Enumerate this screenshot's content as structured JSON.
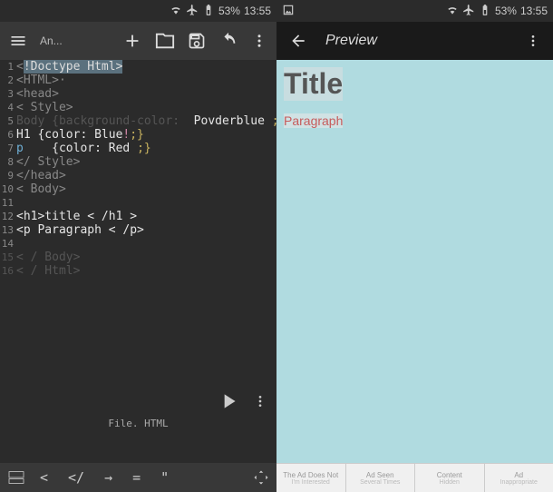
{
  "status_left": {
    "battery": "53%",
    "time": "13:55"
  },
  "status_right": {
    "battery": "53%",
    "time": "13:55"
  },
  "editor": {
    "filename": "An...",
    "file_label": "File. HTML",
    "lines": [
      {
        "n": "1",
        "tokens": [
          {
            "t": "<",
            "c": "tag"
          },
          {
            "t": "!Doctype Html",
            "c": "highlighted"
          },
          {
            "t": ">",
            "c": "highlighted"
          }
        ]
      },
      {
        "n": "2",
        "tokens": [
          {
            "t": "<HTML>·",
            "c": "tag"
          }
        ]
      },
      {
        "n": "3",
        "tokens": [
          {
            "t": "<head>",
            "c": "tag"
          }
        ]
      },
      {
        "n": "4",
        "tokens": [
          {
            "t": "< Style>",
            "c": "tag"
          }
        ]
      },
      {
        "n": "5",
        "tokens": [
          {
            "t": "Body {background-color",
            "c": "text-dim"
          },
          {
            "t": ": ",
            "c": "text-dim"
          },
          {
            "t": " Povderblue ",
            "c": "text-bright"
          },
          {
            "t": "; }",
            "c": "text-yellow"
          }
        ]
      },
      {
        "n": "6",
        "tokens": [
          {
            "t": "H1 {color: Blue",
            "c": "text-bright"
          },
          {
            "t": "!",
            "c": "text-pink"
          },
          {
            "t": ";}",
            "c": "text-yellow"
          }
        ]
      },
      {
        "n": "7",
        "tokens": [
          {
            "t": "p",
            "c": "text-blue"
          },
          {
            "t": "    {color: Red ",
            "c": "text-bright"
          },
          {
            "t": ";}",
            "c": "text-yellow"
          }
        ]
      },
      {
        "n": "8",
        "tokens": [
          {
            "t": "</ Style>",
            "c": "tag"
          }
        ]
      },
      {
        "n": "9",
        "tokens": [
          {
            "t": "</head>",
            "c": "tag"
          }
        ]
      },
      {
        "n": "10",
        "tokens": [
          {
            "t": "< Body>",
            "c": "tag"
          }
        ]
      },
      {
        "n": "11",
        "tokens": []
      },
      {
        "n": "12",
        "tokens": [
          {
            "t": "<h1>title < /h1 >",
            "c": "text-bright"
          }
        ]
      },
      {
        "n": "13",
        "tokens": [
          {
            "t": "<p Paragraph < /p>",
            "c": "text-bright"
          }
        ]
      },
      {
        "n": "14",
        "tokens": []
      },
      {
        "n": "15",
        "dim": true,
        "tokens": [
          {
            "t": "< / Body>",
            "c": "text-dim"
          }
        ]
      },
      {
        "n": "16",
        "dim": true,
        "tokens": [
          {
            "t": "< / Html>",
            "c": "text-dim"
          }
        ]
      }
    ],
    "keyboard_shortcuts": [
      "<",
      "</",
      "→",
      "=",
      "\"",
      "⤢"
    ]
  },
  "preview": {
    "title_label": "Preview",
    "title": "Title",
    "paragraph": "Paragraph"
  },
  "ads": [
    {
      "line1": "The Ad Does Not",
      "line2": "I'm Interested"
    },
    {
      "line1": "Ad Seen",
      "line2": "Several Times"
    },
    {
      "line1": "Content",
      "line2": "Hidden"
    },
    {
      "line1": "Ad",
      "line2": "Inappropriate"
    }
  ]
}
